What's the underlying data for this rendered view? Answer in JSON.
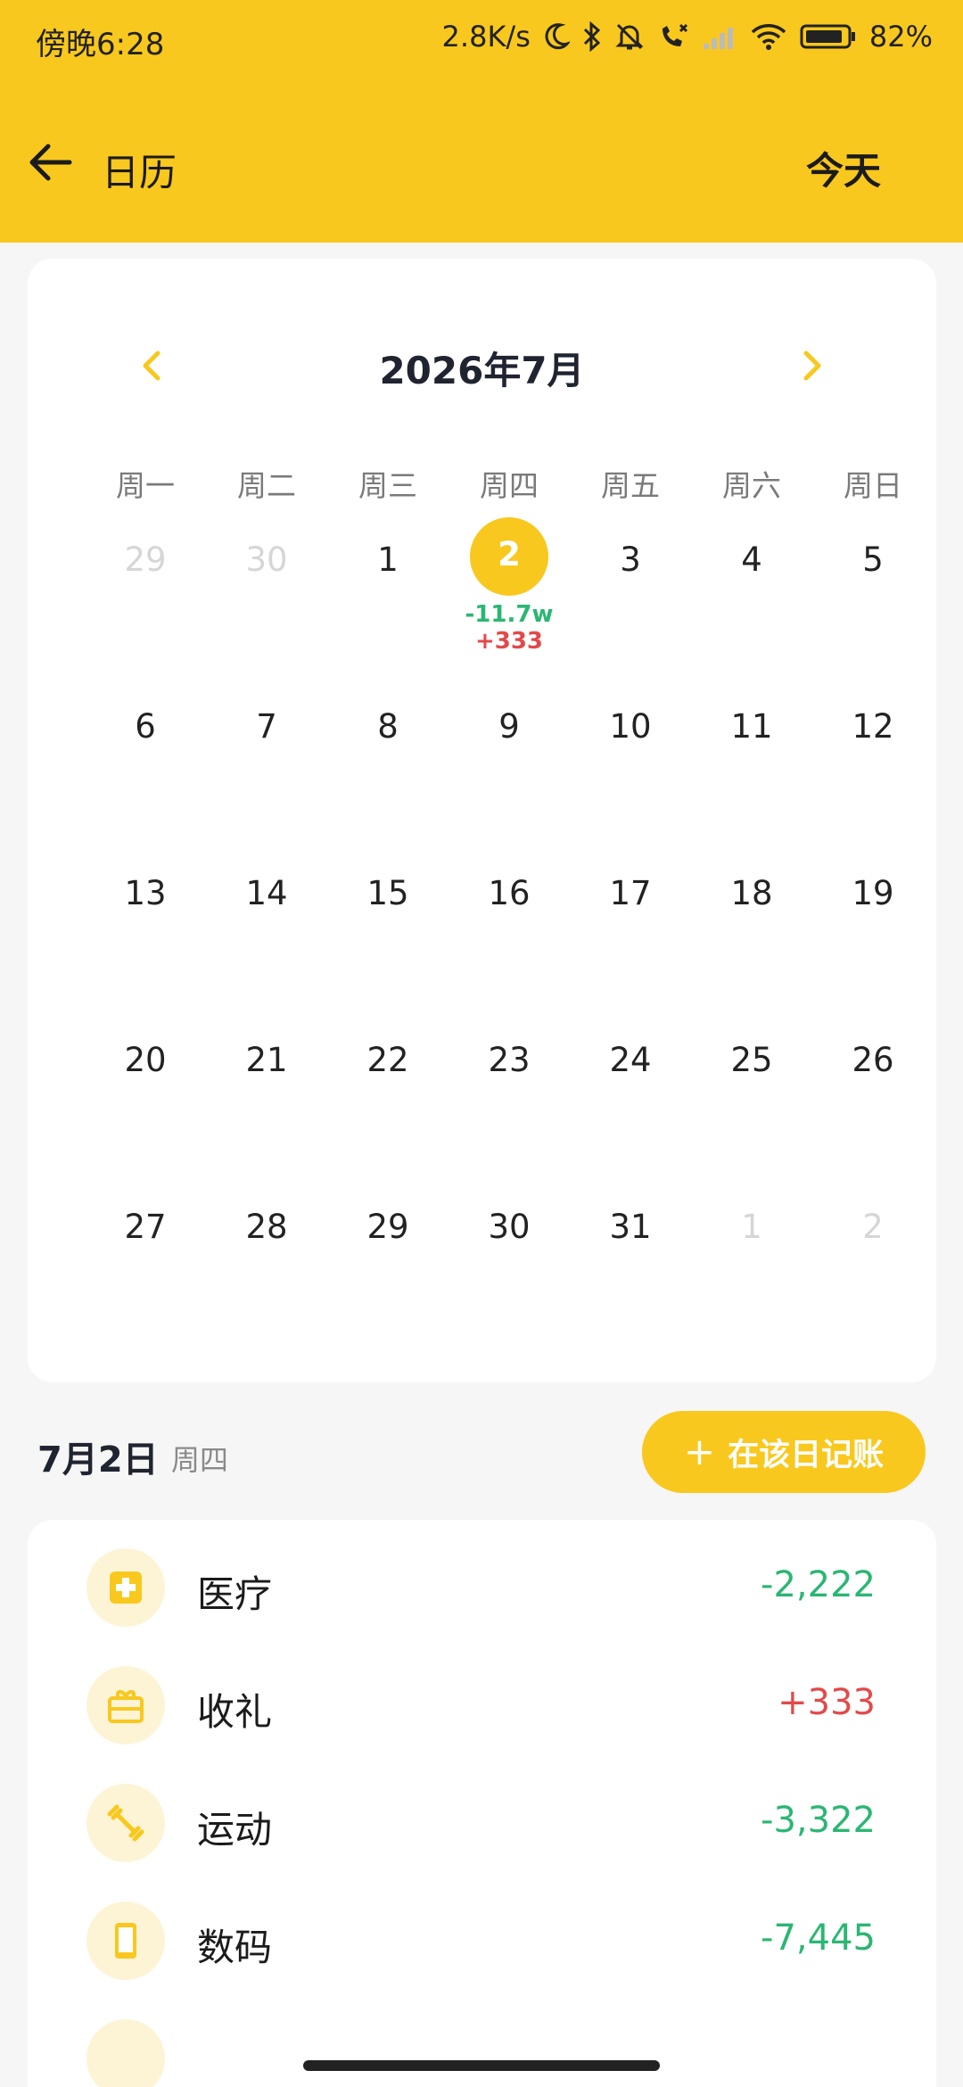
{
  "status_bar": {
    "time": "傍晚6:28",
    "net_speed": "2.8K/s",
    "battery": "82%"
  },
  "header": {
    "title": "日历",
    "today_label": "今天"
  },
  "calendar": {
    "month_title": "2026年7月",
    "weekdays": [
      "周一",
      "周二",
      "周三",
      "周四",
      "周五",
      "周六",
      "周日"
    ],
    "weeks": [
      [
        {
          "n": "29",
          "other": true
        },
        {
          "n": "30",
          "other": true
        },
        {
          "n": "1"
        },
        {
          "n": "2",
          "selected": true,
          "expense": "-11.7w",
          "income": "+333"
        },
        {
          "n": "3"
        },
        {
          "n": "4"
        },
        {
          "n": "5"
        }
      ],
      [
        {
          "n": "6"
        },
        {
          "n": "7"
        },
        {
          "n": "8"
        },
        {
          "n": "9"
        },
        {
          "n": "10"
        },
        {
          "n": "11"
        },
        {
          "n": "12"
        }
      ],
      [
        {
          "n": "13"
        },
        {
          "n": "14"
        },
        {
          "n": "15"
        },
        {
          "n": "16"
        },
        {
          "n": "17"
        },
        {
          "n": "18"
        },
        {
          "n": "19"
        }
      ],
      [
        {
          "n": "20"
        },
        {
          "n": "21"
        },
        {
          "n": "22"
        },
        {
          "n": "23"
        },
        {
          "n": "24"
        },
        {
          "n": "25"
        },
        {
          "n": "26"
        }
      ],
      [
        {
          "n": "27"
        },
        {
          "n": "28"
        },
        {
          "n": "29"
        },
        {
          "n": "30"
        },
        {
          "n": "31"
        },
        {
          "n": "1",
          "other": true
        },
        {
          "n": "2",
          "other": true
        }
      ]
    ]
  },
  "selected_day": {
    "date": "7月2日",
    "weekday": "周四",
    "add_label": "在该日记账"
  },
  "records": [
    {
      "category": "医疗",
      "amount": "-2,222",
      "kind": "neg",
      "icon": "medical-icon"
    },
    {
      "category": "收礼",
      "amount": "+333",
      "kind": "pos",
      "icon": "gift-icon"
    },
    {
      "category": "运动",
      "amount": "-3,322",
      "kind": "neg",
      "icon": "dumbbell-icon"
    },
    {
      "category": "数码",
      "amount": "-7,445",
      "kind": "neg",
      "icon": "phone-icon"
    }
  ],
  "colors": {
    "accent": "#f9c81e",
    "expense": "#2bb673",
    "income": "#e24a4a"
  }
}
